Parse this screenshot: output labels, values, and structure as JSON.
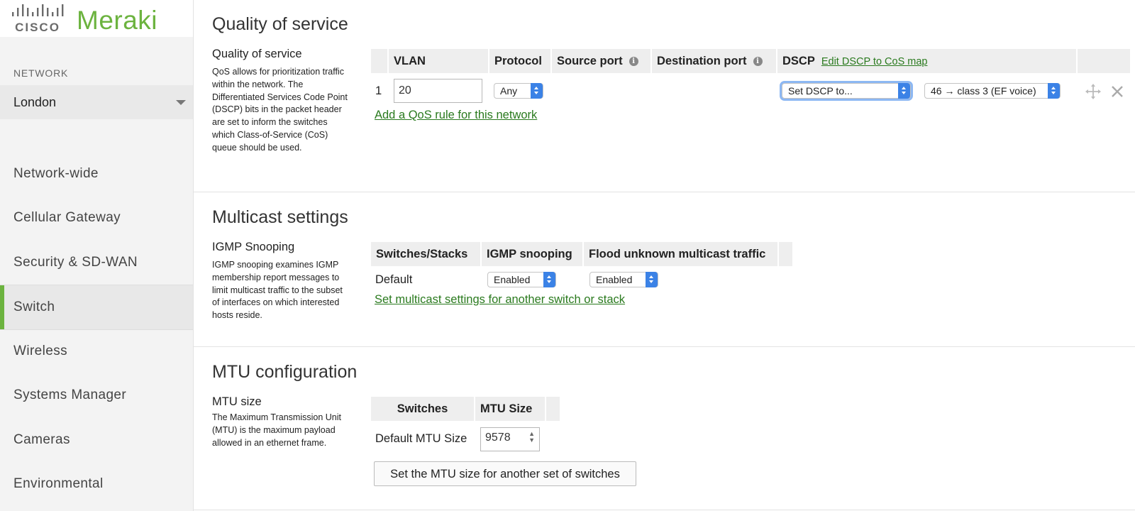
{
  "brand": {
    "cisco": "CISCO",
    "meraki": "Meraki",
    "accent_color": "#6cb33f"
  },
  "sidebar": {
    "network_label": "NETWORK",
    "network_name": "London",
    "items": [
      {
        "label": "Network-wide",
        "active": false
      },
      {
        "label": "Cellular Gateway",
        "active": false
      },
      {
        "label": "Security & SD-WAN",
        "active": false
      },
      {
        "label": "Switch",
        "active": true
      },
      {
        "label": "Wireless",
        "active": false
      },
      {
        "label": "Systems Manager",
        "active": false
      },
      {
        "label": "Cameras",
        "active": false
      },
      {
        "label": "Environmental",
        "active": false
      }
    ]
  },
  "qos": {
    "section_title": "Quality of service",
    "subtitle": "Quality of service",
    "description": "QoS allows for prioritization traffic within the network. The Differentiated Services Code Point (DSCP) bits in the packet header are set to inform the switches which Class-of-Service (CoS) queue should be used.",
    "columns": {
      "vlan": "VLAN",
      "protocol": "Protocol",
      "source_port": "Source port",
      "destination_port": "Destination port",
      "dscp": "DSCP"
    },
    "edit_map_link": "Edit DSCP to CoS map",
    "rows": [
      {
        "index": "1",
        "vlan": "20",
        "protocol": "Any",
        "dscp_action": "Set DSCP to...",
        "dscp_value": "46 → class 3 (EF voice)"
      }
    ],
    "add_rule_link": "Add a QoS rule for this network"
  },
  "multicast": {
    "section_title": "Multicast settings",
    "subtitle": "IGMP Snooping",
    "description": "IGMP snooping examines IGMP membership report messages to limit multicast traffic to the subset of interfaces on which interested hosts reside.",
    "columns": {
      "switches": "Switches/Stacks",
      "igmp": "IGMP snooping",
      "flood": "Flood unknown multicast traffic"
    },
    "rows": [
      {
        "name": "Default",
        "igmp": "Enabled",
        "flood": "Enabled"
      }
    ],
    "add_link": "Set multicast settings for another switch or stack"
  },
  "mtu": {
    "section_title": "MTU configuration",
    "subtitle": "MTU size",
    "description": "The Maximum Transmission Unit (MTU) is the maximum payload allowed in an ethernet frame.",
    "columns": {
      "switches": "Switches",
      "size": "MTU Size"
    },
    "rows": [
      {
        "name": "Default MTU Size",
        "value": "9578"
      }
    ],
    "button_label": "Set the MTU size for another set of switches"
  }
}
